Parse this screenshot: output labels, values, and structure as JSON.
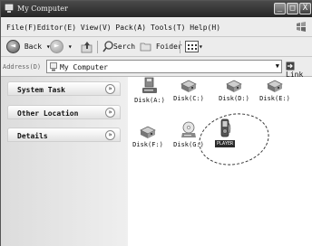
{
  "window": {
    "title": "My Computer",
    "controls": {
      "minimize": "_",
      "maximize": "□",
      "close": "X"
    }
  },
  "menubar": {
    "text": "File(F)Editor(E) View(V) Pack(A) Tools(T) Help(H)"
  },
  "toolbar": {
    "back_label": "Back",
    "search_label": "Serch",
    "folder_label": "Foider",
    "dropdown_glyph": "▾"
  },
  "address": {
    "label": "Address(D)",
    "value": "My Computer",
    "go_label": "Link"
  },
  "sidebar": {
    "panels": [
      {
        "label": "System Task",
        "toggle": "»"
      },
      {
        "label": "Other Location",
        "toggle": "»"
      },
      {
        "label": "Details",
        "toggle": "»"
      }
    ]
  },
  "drives": [
    {
      "label": "Disk(A:)",
      "icon": "floppy-drive-icon"
    },
    {
      "label": "Disk(C:)",
      "icon": "hard-drive-icon"
    },
    {
      "label": "Disk(D:)",
      "icon": "hard-drive-icon"
    },
    {
      "label": "Disk(E:)",
      "icon": "hard-drive-icon"
    },
    {
      "label": "Disk(F:)",
      "icon": "hard-drive-icon"
    },
    {
      "label": "Disk(G:)",
      "icon": "cd-drive-icon"
    },
    {
      "label": "PLAYER",
      "icon": "player-device-icon"
    }
  ]
}
